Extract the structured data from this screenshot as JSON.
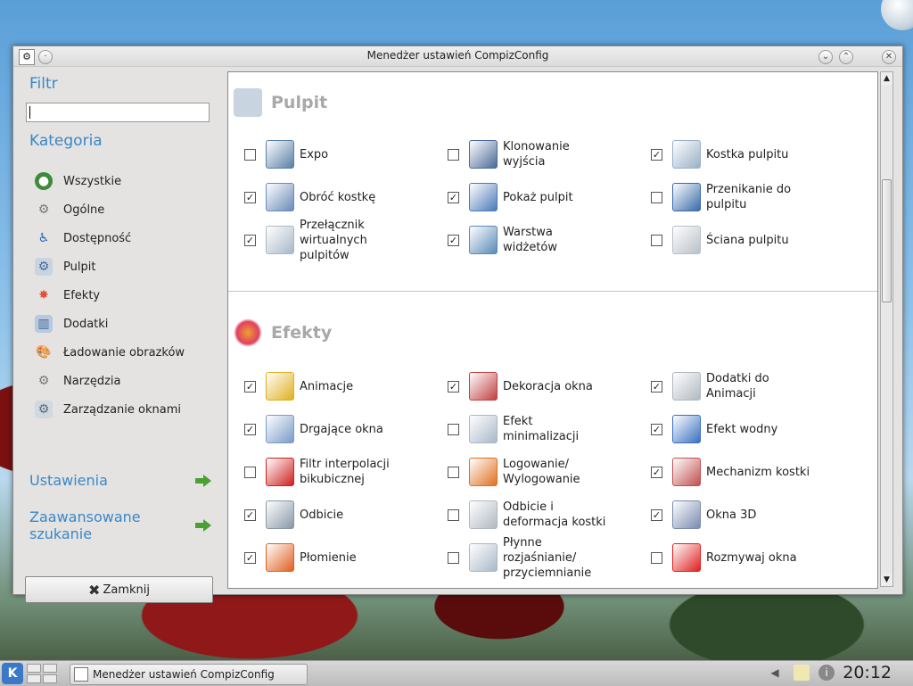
{
  "window": {
    "title": "Menedżer ustawień CompizConfig"
  },
  "sidebar": {
    "filter_heading": "Filtr",
    "search_value": "",
    "category_heading": "Kategoria",
    "categories": [
      {
        "label": "Wszystkie",
        "icon": "globe-icon",
        "color": "#3d8a3d"
      },
      {
        "label": "Ogólne",
        "icon": "gear-icon",
        "color": "#8a8a8a"
      },
      {
        "label": "Dostępność",
        "icon": "wheelchair-icon",
        "color": "#2a66b8"
      },
      {
        "label": "Pulpit",
        "icon": "desktop-gear-icon",
        "color": "#5a7fa8"
      },
      {
        "label": "Efekty",
        "icon": "fireworks-icon",
        "color": "#e0503a"
      },
      {
        "label": "Dodatki",
        "icon": "books-icon",
        "color": "#6a8ab8"
      },
      {
        "label": "Ładowanie obrazków",
        "icon": "palette-icon",
        "color": "#c07a30"
      },
      {
        "label": "Narzędzia",
        "icon": "tools-icon",
        "color": "#8a8a8a"
      },
      {
        "label": "Zarządzanie oknami",
        "icon": "window-gear-icon",
        "color": "#6a7a8a"
      }
    ],
    "settings_link": "Ustawienia",
    "advanced_search_link": "Zaawansowane szukanie",
    "close_button": "Zamknij"
  },
  "groups": {
    "desktop": {
      "title": "Pulpit",
      "plugins": [
        {
          "label": "Expo",
          "checked": false,
          "icon": "expo-icon",
          "color": "#5a7fa8"
        },
        {
          "label": "Klonowanie wyjścia",
          "checked": false,
          "icon": "clone-output-icon",
          "color": "#4a6a98"
        },
        {
          "label": "Kostka pulpitu",
          "checked": true,
          "icon": "cube-icon",
          "color": "#9ab0c8"
        },
        {
          "label": "Obróć kostkę",
          "checked": true,
          "icon": "rotate-cube-icon",
          "color": "#6a8ab8"
        },
        {
          "label": "Pokaż pulpit",
          "checked": true,
          "icon": "show-desktop-icon",
          "color": "#4a7ab8"
        },
        {
          "label": "Przenikanie do pulpitu",
          "checked": false,
          "icon": "fade-desktop-icon",
          "color": "#3a6aa8"
        },
        {
          "label": "Przełącznik wirtualnych pulpitów",
          "checked": true,
          "icon": "desktop-switcher-icon",
          "color": "#a8b8c8"
        },
        {
          "label": "Warstwa widżetów",
          "checked": true,
          "icon": "widget-layer-icon",
          "color": "#5a8ab8"
        },
        {
          "label": "Ściana pulpitu",
          "checked": false,
          "icon": "wall-icon",
          "color": "#b8c0c8"
        }
      ]
    },
    "effects": {
      "title": "Efekty",
      "plugins": [
        {
          "label": "Animacje",
          "checked": true,
          "icon": "magic-lamp-icon",
          "color": "#e0b020"
        },
        {
          "label": "Dekoracja okna",
          "checked": true,
          "icon": "window-decoration-icon",
          "color": "#c04040"
        },
        {
          "label": "Dodatki do Animacji",
          "checked": true,
          "icon": "paper-plane-icon",
          "color": "#b0b8c0"
        },
        {
          "label": "Drgające okna",
          "checked": true,
          "icon": "wobbly-icon",
          "color": "#7a9ac8"
        },
        {
          "label": "Efekt minimalizacji",
          "checked": false,
          "icon": "minimize-icon",
          "color": "#a8b8c8"
        },
        {
          "label": "Efekt wodny",
          "checked": true,
          "icon": "water-drop-icon",
          "color": "#3a70c0"
        },
        {
          "label": "Filtr interpolacji bikubicznej",
          "checked": false,
          "icon": "red-dot-icon",
          "color": "#d02020"
        },
        {
          "label": "Logowanie/ Wylogowanie",
          "checked": false,
          "icon": "login-logout-icon",
          "color": "#e07020"
        },
        {
          "label": "Mechanizm kostki",
          "checked": true,
          "icon": "cube-gears-icon",
          "color": "#c05050"
        },
        {
          "label": "Odbicie",
          "checked": true,
          "icon": "reflection-icon",
          "color": "#8898a8"
        },
        {
          "label": "Odbicie i deformacja kostki",
          "checked": false,
          "icon": "cylinder-icon",
          "color": "#b0b8c0"
        },
        {
          "label": "Okna 3D",
          "checked": true,
          "icon": "windows-3d-icon",
          "color": "#7a8ab0"
        },
        {
          "label": "Płomienie",
          "checked": true,
          "icon": "flame-icon",
          "color": "#e06020"
        },
        {
          "label": "Płynne rozjaśnianie/ przyciemnianie",
          "checked": false,
          "icon": "fade-icon",
          "color": "#a8b8c8"
        },
        {
          "label": "Rozmywaj okna",
          "checked": false,
          "icon": "blur-icon",
          "color": "#e02020"
        }
      ]
    }
  },
  "taskbar": {
    "task_label": "Menedżer ustawień CompizConfig",
    "clock": "20:12"
  }
}
